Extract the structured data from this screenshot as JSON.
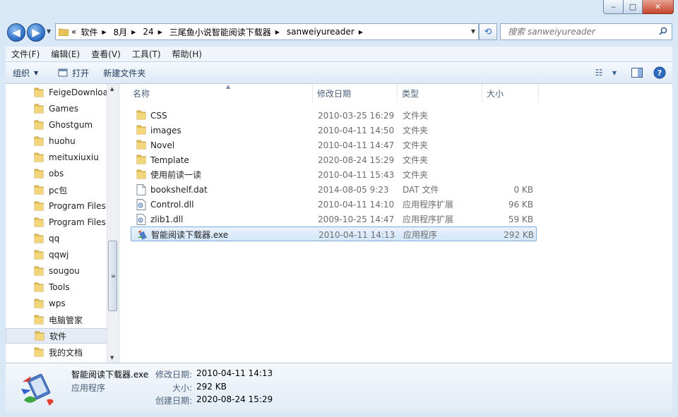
{
  "window": {
    "minimize_glyph": "‒",
    "maximize_glyph": "□",
    "close_glyph": "✕"
  },
  "nav": {
    "back_glyph": "◀",
    "forward_glyph": "▶",
    "refresh_glyph": "⟲",
    "breadcrumb_prefix": "«",
    "breadcrumbs": [
      "软件",
      "8月",
      "24",
      "三尾鱼小说智能阅读下载器",
      "sanweiyureader"
    ],
    "search_placeholder": "搜索 sanweiyureader"
  },
  "menu": [
    "文件(F)",
    "编辑(E)",
    "查看(V)",
    "工具(T)",
    "帮助(H)"
  ],
  "commands": {
    "organize": "组织",
    "open": "打开",
    "new_folder": "新建文件夹"
  },
  "tree": [
    {
      "label": "FeigeDownloa",
      "selected": false
    },
    {
      "label": "Games",
      "selected": false
    },
    {
      "label": "Ghostgum",
      "selected": false
    },
    {
      "label": "huohu",
      "selected": false
    },
    {
      "label": "meituxiuxiu",
      "selected": false
    },
    {
      "label": "obs",
      "selected": false
    },
    {
      "label": "pc包",
      "selected": false
    },
    {
      "label": "Program Files",
      "selected": false
    },
    {
      "label": "Program Files",
      "selected": false
    },
    {
      "label": "qq",
      "selected": false
    },
    {
      "label": "qqwj",
      "selected": false
    },
    {
      "label": "sougou",
      "selected": false
    },
    {
      "label": "Tools",
      "selected": false
    },
    {
      "label": "wps",
      "selected": false
    },
    {
      "label": "电脑管家",
      "selected": false
    },
    {
      "label": "软件",
      "selected": true
    },
    {
      "label": "我的文档",
      "selected": false
    }
  ],
  "columns": {
    "name": "名称",
    "date": "修改日期",
    "type": "类型",
    "size": "大小"
  },
  "files": [
    {
      "name": "CSS",
      "date": "2010-03-25 16:29",
      "type": "文件夹",
      "size": "",
      "icon": "folder-icon",
      "selected": false
    },
    {
      "name": "images",
      "date": "2010-04-11 14:50",
      "type": "文件夹",
      "size": "",
      "icon": "folder-icon",
      "selected": false
    },
    {
      "name": "Novel",
      "date": "2010-04-11 14:47",
      "type": "文件夹",
      "size": "",
      "icon": "folder-icon",
      "selected": false
    },
    {
      "name": "Template",
      "date": "2020-08-24 15:29",
      "type": "文件夹",
      "size": "",
      "icon": "folder-icon",
      "selected": false
    },
    {
      "name": "使用前读一读",
      "date": "2010-04-11 15:43",
      "type": "文件夹",
      "size": "",
      "icon": "folder-icon",
      "selected": false
    },
    {
      "name": "bookshelf.dat",
      "date": "2014-08-05 9:23",
      "type": "DAT 文件",
      "size": "0 KB",
      "icon": "document-icon",
      "selected": false
    },
    {
      "name": "Control.dll",
      "date": "2010-04-11 14:10",
      "type": "应用程序扩展",
      "size": "96 KB",
      "icon": "dll-icon",
      "selected": false
    },
    {
      "name": "zlib1.dll",
      "date": "2009-10-25 14:47",
      "type": "应用程序扩展",
      "size": "59 KB",
      "icon": "dll-icon",
      "selected": false
    },
    {
      "name": "智能阅读下载器.exe",
      "date": "2010-04-11 14:13",
      "type": "应用程序",
      "size": "292 KB",
      "icon": "exe-icon",
      "selected": true
    }
  ],
  "details": {
    "name": "智能阅读下载器.exe",
    "type": "应用程序",
    "modified_label": "修改日期:",
    "modified_value": "2010-04-11 14:13",
    "size_label": "大小:",
    "size_value": "292 KB",
    "created_label": "创建日期:",
    "created_value": "2020-08-24 15:29"
  }
}
